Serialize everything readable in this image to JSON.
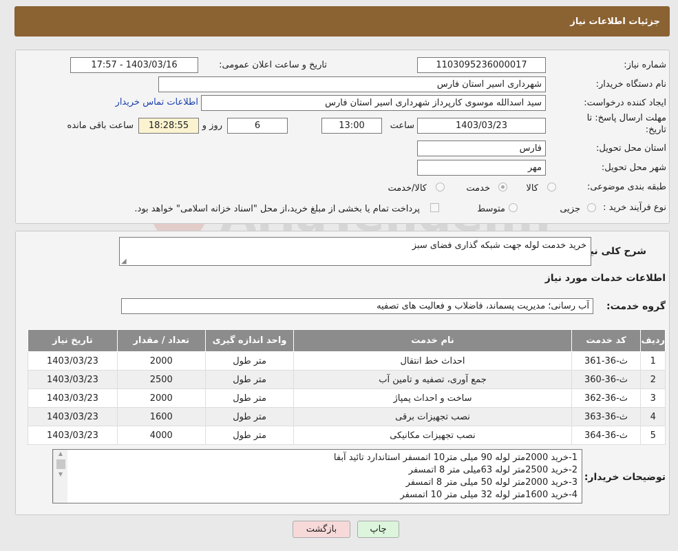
{
  "header": {
    "title": "جزئیات اطلاعات نیاز"
  },
  "form": {
    "need_number_label": "شماره نیاز:",
    "need_number": "1103095236000017",
    "announce_label": "تاریخ و ساعت اعلان عمومی:",
    "announce_value": "1403/03/16 - 17:57",
    "buyer_org_label": "نام دستگاه خریدار:",
    "buyer_org": "شهرداری اسیر استان فارس",
    "creator_label": "ایجاد کننده درخواست:",
    "creator": "سید اسدالله موسوی کارپرداز شهرداری اسیر استان فارس",
    "contact_link": "اطلاعات تماس خریدار",
    "deadline_label_1": "مهلت ارسال پاسخ: تا",
    "deadline_label_2": "تاریخ:",
    "deadline_date": "1403/03/23",
    "time_label": "ساعت",
    "deadline_time": "13:00",
    "days": "6",
    "days_label": "روز و",
    "remaining": "18:28:55",
    "remaining_label": "ساعت باقی مانده",
    "province_label": "استان محل تحویل:",
    "province": "فارس",
    "city_label": "شهر محل تحویل:",
    "city": "مهر",
    "category_label": "طبقه بندی موضوعی:",
    "category_options": [
      "کالا",
      "خدمت",
      "کالا/خدمت"
    ],
    "category_selected": "خدمت",
    "process_label": "نوع فرآیند خرید :",
    "process_options": [
      "جزیی",
      "متوسط"
    ],
    "payment_note": "پرداخت تمام یا بخشی از مبلغ خرید،از محل \"اسناد خزانه اسلامی\" خواهد بود."
  },
  "summary": {
    "label": "شرح کلی نیاز:",
    "value": "خرید خدمت لوله جهت شبکه گذاری فضای سبز"
  },
  "services": {
    "title": "اطلاعات خدمات مورد نیاز",
    "group_label": "گروه خدمت:",
    "group_value": "آب رسانی؛ مدیریت پسماند، فاضلاب و فعالیت های تصفیه",
    "columns": [
      "ردیف",
      "کد خدمت",
      "نام خدمت",
      "واحد اندازه گیری",
      "تعداد / مقدار",
      "تاریخ نیاز"
    ],
    "rows": [
      {
        "idx": "1",
        "code": "ث-36-361",
        "name": "احداث خط انتقال",
        "unit": "متر طول",
        "qty": "2000",
        "date": "1403/03/23"
      },
      {
        "idx": "2",
        "code": "ث-36-360",
        "name": "جمع آوری، تصفیه و تامین آب",
        "unit": "متر طول",
        "qty": "2500",
        "date": "1403/03/23"
      },
      {
        "idx": "3",
        "code": "ث-36-362",
        "name": "ساخت و احداث پمپاژ",
        "unit": "متر طول",
        "qty": "2000",
        "date": "1403/03/23"
      },
      {
        "idx": "4",
        "code": "ث-36-363",
        "name": "نصب تجهیزات برقی",
        "unit": "متر طول",
        "qty": "1600",
        "date": "1403/03/23"
      },
      {
        "idx": "5",
        "code": "ث-36-364",
        "name": "نصب تجهیزات مکانیکی",
        "unit": "متر طول",
        "qty": "4000",
        "date": "1403/03/23"
      }
    ]
  },
  "buyer_notes": {
    "label": "توضیحات خریدار:",
    "lines": [
      "1-خرید  2000متر لوله 90 میلی متر10 اتمسفر استاندارد تائید آبفا",
      "2-خرید 2500متر لوله 63میلی متر 8 اتمسفر",
      "3-خرید 2000متر لوله 50 میلی متر 8 اتمسفر",
      "4-خرید 1600متر لوله 32 میلی متر 10 اتمسفر"
    ]
  },
  "buttons": {
    "print": "چاپ",
    "back": "بازگشت"
  },
  "watermark": "AriaTender.neT",
  "colors": {
    "header": "#8b6232",
    "table_header": "#8c8c8c",
    "link": "#1a3fb0",
    "back_button": "#f8d9d9",
    "print_button": "#dcf5dc"
  }
}
